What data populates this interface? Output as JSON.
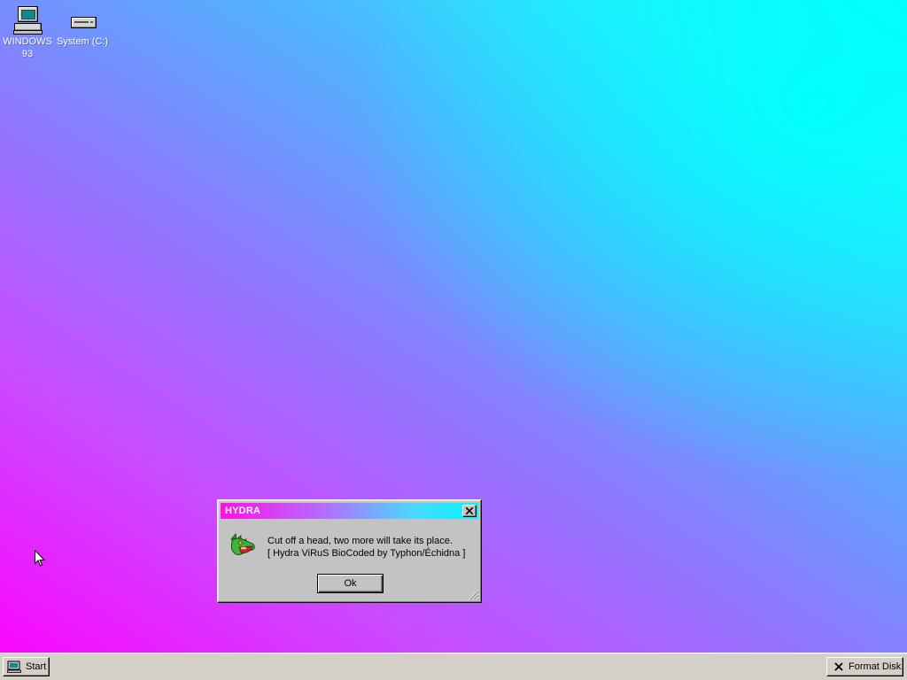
{
  "desktop": {
    "icons": [
      {
        "label": "WINDOWS 93",
        "icon": "computer-icon"
      },
      {
        "label": "System (C:)",
        "icon": "drive-icon"
      }
    ]
  },
  "dialog": {
    "title": "HYDRA",
    "icon": "hydra-dragon-icon",
    "message_line1": "Cut off a head, two more will take its place.",
    "message_line2": "[ Hydra ViRuS BioCoded by Typhon/Échidna ]",
    "ok_label": "Ok"
  },
  "taskbar": {
    "start_label": "Start",
    "tasks": [
      {
        "label": "Format Disk",
        "icon": "close-x-icon"
      }
    ]
  },
  "colors": {
    "title_gradient": [
      "#ff10e6",
      "#00f6ff"
    ],
    "face": "#c3c3c3"
  }
}
